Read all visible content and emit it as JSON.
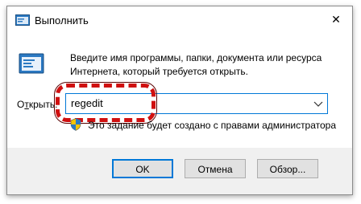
{
  "window": {
    "title": "Выполнить",
    "close_glyph": "✕"
  },
  "dialog": {
    "description": "Введите имя программы, папки, документа или ресурса Интернета, который требуется открыть.",
    "open_label_prefix": "О",
    "open_label_underlined": "т",
    "open_label_suffix": "крыть:",
    "input_value": "regedit",
    "admin_note": "Это задание будет создано с правами администратора"
  },
  "buttons": {
    "ok": "OK",
    "cancel": "Отмена",
    "browse": "Обзор..."
  },
  "icons": {
    "app": "run-dialog-icon",
    "run": "run-program-icon",
    "shield": "uac-shield-icon",
    "dropdown": "chevron-down-icon",
    "close": "close-icon"
  },
  "colors": {
    "accent": "#0078d7",
    "highlight": "#d01010",
    "footer_bg": "#f0f0f0",
    "button_bg": "#e1e1e1"
  }
}
